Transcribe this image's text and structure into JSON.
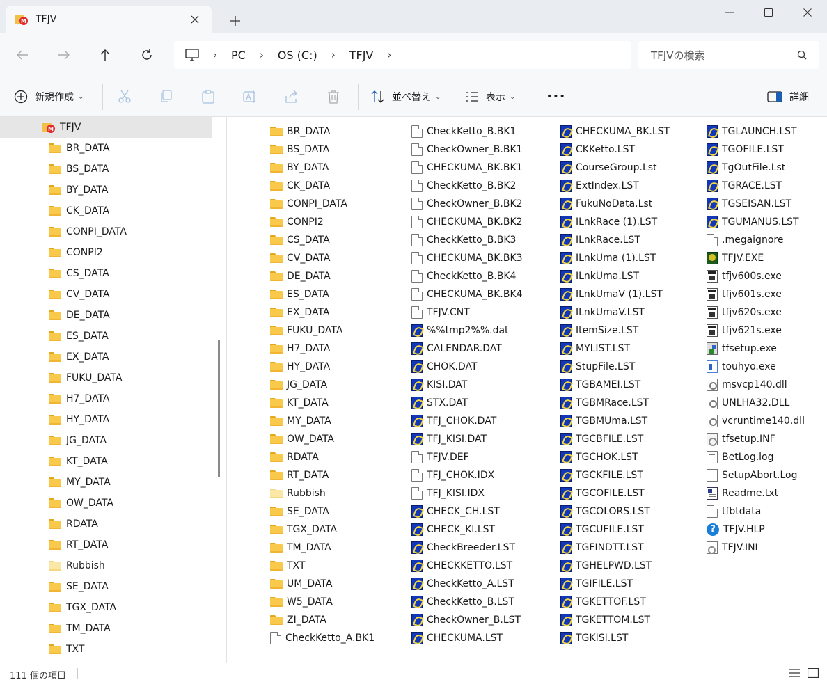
{
  "window": {
    "tab_title": "TFJV",
    "new_tab_symbol": "+",
    "close_tab_symbol": "✕"
  },
  "address": {
    "crumbs": [
      "PC",
      "OS (C:)",
      "TFJV"
    ],
    "search_placeholder": "TFJVの検索"
  },
  "toolbar": {
    "new_label": "新規作成",
    "sort_label": "並べ替え",
    "view_label": "表示",
    "more_label": "•••",
    "details_label": "詳細"
  },
  "sidebar": {
    "root": "TFJV",
    "items": [
      "BR_DATA",
      "BS_DATA",
      "BY_DATA",
      "CK_DATA",
      "CONPI_DATA",
      "CONPI2",
      "CS_DATA",
      "CV_DATA",
      "DE_DATA",
      "ES_DATA",
      "EX_DATA",
      "FUKU_DATA",
      "H7_DATA",
      "HY_DATA",
      "JG_DATA",
      "KT_DATA",
      "MY_DATA",
      "OW_DATA",
      "RDATA",
      "RT_DATA",
      "Rubbish",
      "SE_DATA",
      "TGX_DATA",
      "TM_DATA",
      "TXT"
    ]
  },
  "files": {
    "col1": [
      {
        "name": "BR_DATA",
        "icon": "folder-icon"
      },
      {
        "name": "BS_DATA",
        "icon": "folder-icon"
      },
      {
        "name": "BY_DATA",
        "icon": "folder-icon"
      },
      {
        "name": "CK_DATA",
        "icon": "folder-icon"
      },
      {
        "name": "CONPI_DATA",
        "icon": "folder-icon"
      },
      {
        "name": "CONPI2",
        "icon": "folder-icon"
      },
      {
        "name": "CS_DATA",
        "icon": "folder-icon"
      },
      {
        "name": "CV_DATA",
        "icon": "folder-icon"
      },
      {
        "name": "DE_DATA",
        "icon": "folder-icon"
      },
      {
        "name": "ES_DATA",
        "icon": "folder-icon"
      },
      {
        "name": "EX_DATA",
        "icon": "folder-icon"
      },
      {
        "name": "FUKU_DATA",
        "icon": "folder-icon"
      },
      {
        "name": "H7_DATA",
        "icon": "folder-icon"
      },
      {
        "name": "HY_DATA",
        "icon": "folder-icon"
      },
      {
        "name": "JG_DATA",
        "icon": "folder-icon"
      },
      {
        "name": "KT_DATA",
        "icon": "folder-icon"
      },
      {
        "name": "MY_DATA",
        "icon": "folder-icon"
      },
      {
        "name": "OW_DATA",
        "icon": "folder-icon"
      },
      {
        "name": "RDATA",
        "icon": "folder-icon"
      },
      {
        "name": "RT_DATA",
        "icon": "folder-icon"
      },
      {
        "name": "Rubbish",
        "icon": "folder-empty-icon"
      },
      {
        "name": "SE_DATA",
        "icon": "folder-icon"
      },
      {
        "name": "TGX_DATA",
        "icon": "folder-icon"
      },
      {
        "name": "TM_DATA",
        "icon": "folder-icon"
      },
      {
        "name": "TXT",
        "icon": "folder-icon"
      },
      {
        "name": "UM_DATA",
        "icon": "folder-icon"
      },
      {
        "name": "W5_DATA",
        "icon": "folder-icon"
      },
      {
        "name": "ZI_DATA",
        "icon": "folder-icon"
      },
      {
        "name": "CheckKetto_A.BK1",
        "icon": "file-icon"
      }
    ],
    "col2": [
      {
        "name": "CheckKetto_B.BK1",
        "icon": "file-icon"
      },
      {
        "name": "CheckOwner_B.BK1",
        "icon": "file-icon"
      },
      {
        "name": "CHECKUMA_BK.BK1",
        "icon": "file-icon"
      },
      {
        "name": "CheckKetto_B.BK2",
        "icon": "file-icon"
      },
      {
        "name": "CheckOwner_B.BK2",
        "icon": "file-icon"
      },
      {
        "name": "CHECKUMA_BK.BK2",
        "icon": "file-icon"
      },
      {
        "name": "CheckKetto_B.BK3",
        "icon": "file-icon"
      },
      {
        "name": "CHECKUMA_BK.BK3",
        "icon": "file-icon"
      },
      {
        "name": "CheckKetto_B.BK4",
        "icon": "file-icon"
      },
      {
        "name": "CHECKUMA_BK.BK4",
        "icon": "file-icon"
      },
      {
        "name": "TFJV.CNT",
        "icon": "file-icon"
      },
      {
        "name": "%%tmp2%%.dat",
        "icon": "tfjv-data-icon"
      },
      {
        "name": "CALENDAR.DAT",
        "icon": "tfjv-data-icon"
      },
      {
        "name": "CHOK.DAT",
        "icon": "tfjv-data-icon"
      },
      {
        "name": "KISI.DAT",
        "icon": "tfjv-data-icon"
      },
      {
        "name": "STX.DAT",
        "icon": "tfjv-data-icon"
      },
      {
        "name": "TFJ_CHOK.DAT",
        "icon": "tfjv-data-icon"
      },
      {
        "name": "TFJ_KISI.DAT",
        "icon": "tfjv-data-icon"
      },
      {
        "name": "TFJV.DEF",
        "icon": "file-icon"
      },
      {
        "name": "TFJ_CHOK.IDX",
        "icon": "file-icon"
      },
      {
        "name": "TFJ_KISI.IDX",
        "icon": "file-icon"
      },
      {
        "name": "CHECK_CH.LST",
        "icon": "tfjv-data-icon"
      },
      {
        "name": "CHECK_KI.LST",
        "icon": "tfjv-data-icon"
      },
      {
        "name": "CheckBreeder.LST",
        "icon": "tfjv-data-icon"
      },
      {
        "name": "CHECKKETTO.LST",
        "icon": "tfjv-data-icon"
      },
      {
        "name": "CheckKetto_A.LST",
        "icon": "tfjv-data-icon"
      },
      {
        "name": "CheckKetto_B.LST",
        "icon": "tfjv-data-icon"
      },
      {
        "name": "CheckOwner_B.LST",
        "icon": "tfjv-data-icon"
      },
      {
        "name": "CHECKUMA.LST",
        "icon": "tfjv-data-icon"
      }
    ],
    "col3": [
      {
        "name": "CHECKUMA_BK.LST",
        "icon": "tfjv-data-icon"
      },
      {
        "name": "CKKetto.LST",
        "icon": "tfjv-data-icon"
      },
      {
        "name": "CourseGroup.Lst",
        "icon": "tfjv-data-icon"
      },
      {
        "name": "ExtIndex.LST",
        "icon": "tfjv-data-icon"
      },
      {
        "name": "FukuNoData.Lst",
        "icon": "tfjv-data-icon"
      },
      {
        "name": "ILnkRace (1).LST",
        "icon": "tfjv-data-icon"
      },
      {
        "name": "ILnkRace.LST",
        "icon": "tfjv-data-icon"
      },
      {
        "name": "ILnkUma (1).LST",
        "icon": "tfjv-data-icon"
      },
      {
        "name": "ILnkUma.LST",
        "icon": "tfjv-data-icon"
      },
      {
        "name": "ILnkUmaV (1).LST",
        "icon": "tfjv-data-icon"
      },
      {
        "name": "ILnkUmaV.LST",
        "icon": "tfjv-data-icon"
      },
      {
        "name": "ItemSize.LST",
        "icon": "tfjv-data-icon"
      },
      {
        "name": "MYLIST.LST",
        "icon": "tfjv-data-icon"
      },
      {
        "name": "StupFile.LST",
        "icon": "tfjv-data-icon"
      },
      {
        "name": "TGBAMEI.LST",
        "icon": "tfjv-data-icon"
      },
      {
        "name": "TGBMRace.LST",
        "icon": "tfjv-data-icon"
      },
      {
        "name": "TGBMUma.LST",
        "icon": "tfjv-data-icon"
      },
      {
        "name": "TGCBFILE.LST",
        "icon": "tfjv-data-icon"
      },
      {
        "name": "TGCHOK.LST",
        "icon": "tfjv-data-icon"
      },
      {
        "name": "TGCKFILE.LST",
        "icon": "tfjv-data-icon"
      },
      {
        "name": "TGCOFILE.LST",
        "icon": "tfjv-data-icon"
      },
      {
        "name": "TGCOLORS.LST",
        "icon": "tfjv-data-icon"
      },
      {
        "name": "TGCUFILE.LST",
        "icon": "tfjv-data-icon"
      },
      {
        "name": "TGFINDTT.LST",
        "icon": "tfjv-data-icon"
      },
      {
        "name": "TGHELPWD.LST",
        "icon": "tfjv-data-icon"
      },
      {
        "name": "TGIFILE.LST",
        "icon": "tfjv-data-icon"
      },
      {
        "name": "TGKETTOF.LST",
        "icon": "tfjv-data-icon"
      },
      {
        "name": "TGKETTOM.LST",
        "icon": "tfjv-data-icon"
      },
      {
        "name": "TGKISI.LST",
        "icon": "tfjv-data-icon"
      }
    ],
    "col4": [
      {
        "name": "TGLAUNCH.LST",
        "icon": "tfjv-data-icon"
      },
      {
        "name": "TGOFILE.LST",
        "icon": "tfjv-data-icon"
      },
      {
        "name": "TgOutFile.Lst",
        "icon": "tfjv-data-icon"
      },
      {
        "name": "TGRACE.LST",
        "icon": "tfjv-data-icon"
      },
      {
        "name": "TGSEISAN.LST",
        "icon": "tfjv-data-icon"
      },
      {
        "name": "TGUMANUS.LST",
        "icon": "tfjv-data-icon"
      },
      {
        "name": ".megaignore",
        "icon": "file-icon"
      },
      {
        "name": "TFJV.EXE",
        "icon": "tfjv-app-icon"
      },
      {
        "name": "tfjv600s.exe",
        "icon": "console-app-icon"
      },
      {
        "name": "tfjv601s.exe",
        "icon": "console-app-icon"
      },
      {
        "name": "tfjv620s.exe",
        "icon": "console-app-icon"
      },
      {
        "name": "tfjv621s.exe",
        "icon": "console-app-icon"
      },
      {
        "name": "tfsetup.exe",
        "icon": "setup-icon"
      },
      {
        "name": "touhyo.exe",
        "icon": "app-window-icon"
      },
      {
        "name": "msvcp140.dll",
        "icon": "dll-icon"
      },
      {
        "name": "UNLHA32.DLL",
        "icon": "dll-icon"
      },
      {
        "name": "vcruntime140.dll",
        "icon": "dll-icon"
      },
      {
        "name": "tfsetup.INF",
        "icon": "config-icon"
      },
      {
        "name": "BetLog.log",
        "icon": "log-icon"
      },
      {
        "name": "SetupAbort.Log",
        "icon": "log-icon"
      },
      {
        "name": "Readme.txt",
        "icon": "text-file-icon"
      },
      {
        "name": "tfbtdata",
        "icon": "file-icon"
      },
      {
        "name": "TFJV.HLP",
        "icon": "help-icon"
      },
      {
        "name": "TFJV.INI",
        "icon": "ini-icon"
      }
    ]
  },
  "status": {
    "item_count": "111 個の項目"
  }
}
